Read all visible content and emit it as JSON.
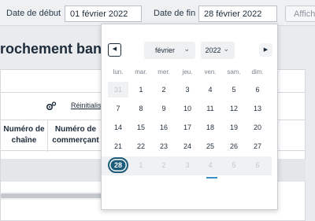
{
  "filters": {
    "start_label": "Date de début",
    "start_value": "01 février 2022",
    "end_label": "Date de fin",
    "end_value": "28 février 2022",
    "show_button": "Affiche"
  },
  "page": {
    "title": "rochement banca"
  },
  "panel": {
    "reset_label": "Réinitialise",
    "columns": [
      "Numéro de chaîne",
      "Numéro de commerçant"
    ],
    "icons": {
      "settings": "gears-icon"
    }
  },
  "calendar": {
    "month": "février",
    "year": "2022",
    "weekdays": [
      "lun.",
      "mar.",
      "mer.",
      "jeu.",
      "ven.",
      "sam.",
      "dim."
    ],
    "weeks": [
      [
        "31",
        "1",
        "2",
        "3",
        "4",
        "5",
        "6"
      ],
      [
        "7",
        "8",
        "9",
        "10",
        "11",
        "12",
        "13"
      ],
      [
        "14",
        "15",
        "16",
        "17",
        "18",
        "19",
        "20"
      ],
      [
        "21",
        "22",
        "23",
        "24",
        "25",
        "26",
        "27"
      ],
      [
        "28",
        "1",
        "2",
        "3",
        "4",
        "5",
        "6"
      ]
    ],
    "selected_day": "28",
    "today_marker_day": "4",
    "accent_color": "#1d5c7a",
    "today_color": "#3a8fc2"
  }
}
